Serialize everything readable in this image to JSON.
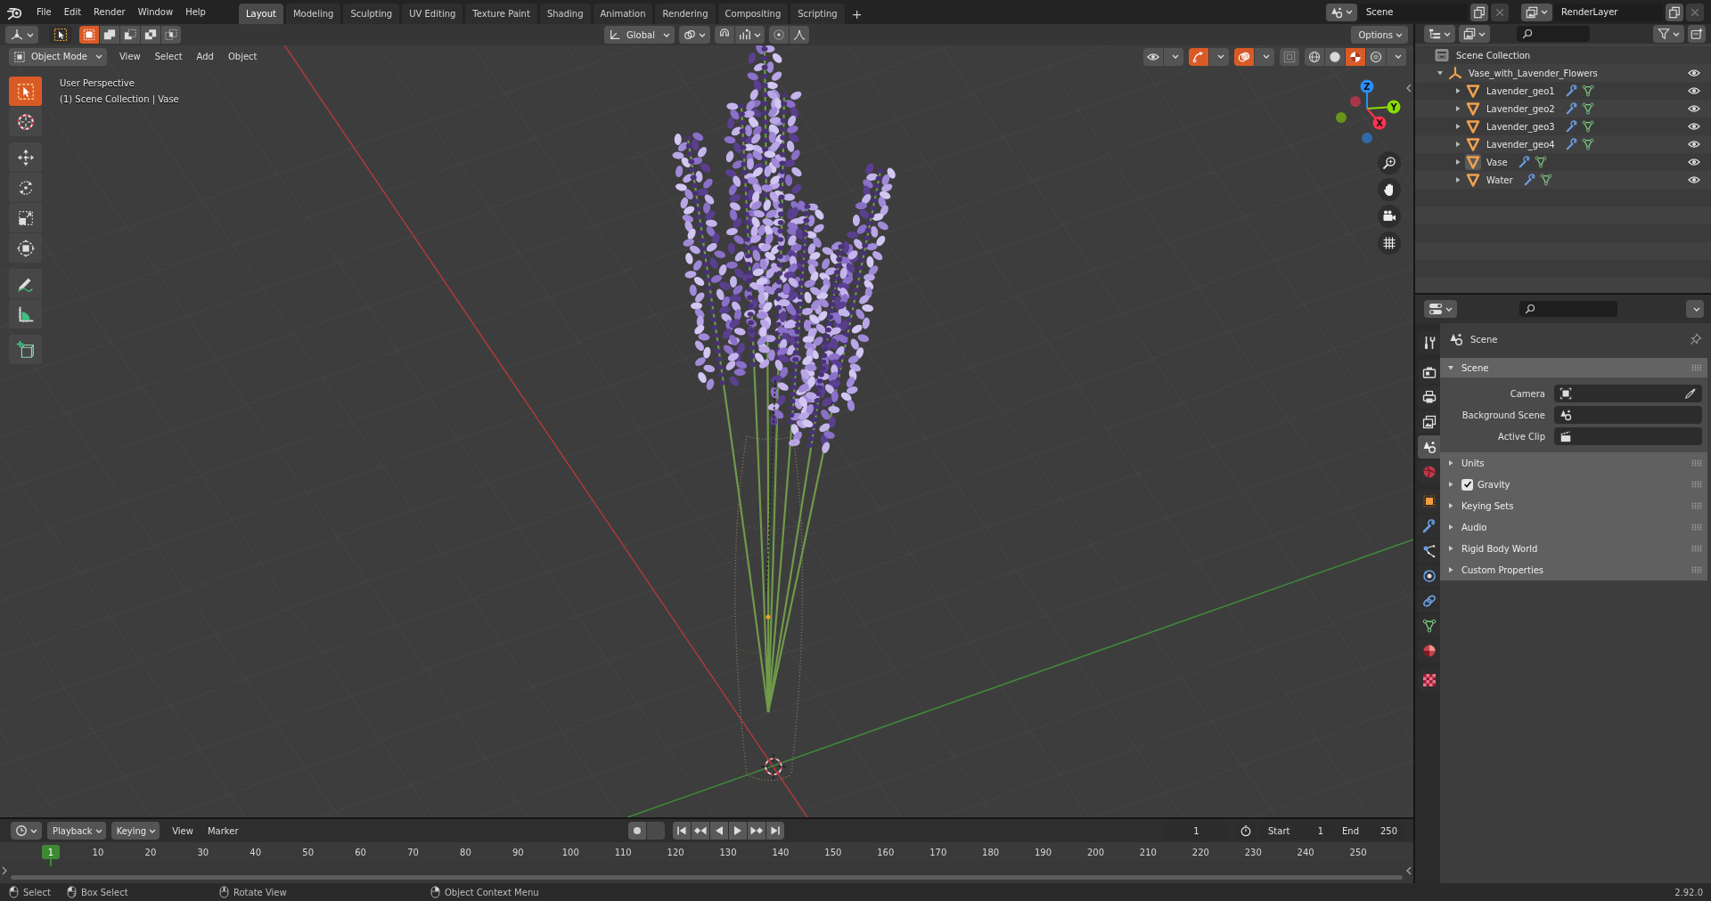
{
  "top_bar": {
    "menus": [
      "File",
      "Edit",
      "Render",
      "Window",
      "Help"
    ],
    "workspaces": [
      {
        "label": "Layout",
        "selected": true
      },
      {
        "label": "Modeling",
        "selected": false
      },
      {
        "label": "Sculpting",
        "selected": false
      },
      {
        "label": "UV Editing",
        "selected": false
      },
      {
        "label": "Texture Paint",
        "selected": false
      },
      {
        "label": "Shading",
        "selected": false
      },
      {
        "label": "Animation",
        "selected": false
      },
      {
        "label": "Rendering",
        "selected": false
      },
      {
        "label": "Compositing",
        "selected": false
      },
      {
        "label": "Scripting",
        "selected": false
      }
    ],
    "add_workspace": "+",
    "scene": "Scene",
    "view_layer": "RenderLayer"
  },
  "tool_header": {
    "selection_modes": [
      {
        "kind": "set",
        "selected": true
      },
      {
        "kind": "extend",
        "selected": false
      },
      {
        "kind": "subtract",
        "selected": false
      },
      {
        "kind": "difference",
        "selected": false
      },
      {
        "kind": "intersect",
        "selected": false
      }
    ],
    "orientation": "Global",
    "snap": false,
    "proportional_editing": false,
    "options": "Options"
  },
  "viewport_header": {
    "mode": "Object Mode",
    "menus": [
      "View",
      "Select",
      "Add",
      "Object"
    ],
    "gizmos": true,
    "overlays": true,
    "xray": false,
    "shading": [
      {
        "kind": "wireframe",
        "selected": false
      },
      {
        "kind": "solid",
        "selected": false
      },
      {
        "kind": "material",
        "selected": true
      },
      {
        "kind": "rendered",
        "selected": false
      }
    ]
  },
  "viewport": {
    "view_name": "User Perspective",
    "context": "(1) Scene Collection | Vase",
    "tools": [
      {
        "kind": "select_box",
        "selected": true
      },
      {
        "kind": "cursor",
        "selected": false
      },
      {
        "kind": "move",
        "selected": false
      },
      {
        "kind": "rotate",
        "selected": false
      },
      {
        "kind": "scale",
        "selected": false
      },
      {
        "kind": "transform",
        "selected": false
      },
      {
        "kind": "annotate",
        "selected": false
      },
      {
        "kind": "measure",
        "selected": false
      },
      {
        "kind": "add_cube",
        "selected": false
      }
    ],
    "gizmo_axes": [
      {
        "label": "Z",
        "color": "#2890ff"
      },
      {
        "label": "Y",
        "color": "#8bdc00"
      },
      {
        "label": "X",
        "color": "#ff3352"
      }
    ]
  },
  "outliner": {
    "tree": {
      "name": "Scene Collection",
      "kind": "scene_collection",
      "children": [
        {
          "name": "Vase_with_Lavender_Flowers",
          "kind": "empty",
          "expanded": true,
          "visible": true,
          "active": false,
          "children": [
            {
              "name": "Lavender_geo1",
              "kind": "mesh",
              "expanded": false,
              "visible": true,
              "active": false
            },
            {
              "name": "Lavender_geo2",
              "kind": "mesh",
              "expanded": false,
              "visible": true,
              "active": false
            },
            {
              "name": "Lavender_geo3",
              "kind": "mesh",
              "expanded": false,
              "visible": true,
              "active": false
            },
            {
              "name": "Lavender_geo4",
              "kind": "mesh",
              "expanded": false,
              "visible": true,
              "active": false
            },
            {
              "name": "Vase",
              "kind": "mesh",
              "expanded": false,
              "visible": true,
              "active": true
            },
            {
              "name": "Water",
              "kind": "mesh",
              "expanded": false,
              "visible": true,
              "active": false
            }
          ]
        }
      ]
    }
  },
  "properties": {
    "tabs": [
      {
        "kind": "tool",
        "selected": false
      },
      {
        "kind": "render",
        "selected": false
      },
      {
        "kind": "output",
        "selected": false
      },
      {
        "kind": "view_layer",
        "selected": false
      },
      {
        "kind": "scene",
        "selected": true
      },
      {
        "kind": "world",
        "selected": false
      },
      {
        "kind": "object",
        "selected": false
      },
      {
        "kind": "modifiers",
        "selected": false
      },
      {
        "kind": "particles",
        "selected": false
      },
      {
        "kind": "physics",
        "selected": false
      },
      {
        "kind": "constraints",
        "selected": false
      },
      {
        "kind": "data",
        "selected": false
      },
      {
        "kind": "material",
        "selected": false
      },
      {
        "kind": "texture",
        "selected": false
      }
    ],
    "context": "Scene",
    "panels": [
      {
        "title": "Scene",
        "kind": "plain",
        "expanded": true,
        "fields": [
          {
            "label": "Camera",
            "kind": "camera"
          },
          {
            "label": "Background Scene",
            "kind": "scene"
          },
          {
            "label": "Active Clip",
            "kind": "clip"
          }
        ]
      },
      {
        "title": "Units",
        "kind": "plain",
        "expanded": false
      },
      {
        "title": "Gravity",
        "kind": "toggle",
        "expanded": false,
        "checked": true
      },
      {
        "title": "Keying Sets",
        "kind": "plain",
        "expanded": false
      },
      {
        "title": "Audio",
        "kind": "plain",
        "expanded": false
      },
      {
        "title": "Rigid Body World",
        "kind": "plain",
        "expanded": false
      },
      {
        "title": "Custom Properties",
        "kind": "plain",
        "expanded": false
      }
    ]
  },
  "timeline": {
    "menus": [
      {
        "label": "Playback",
        "kind": "dropdown"
      },
      {
        "label": "Keying",
        "kind": "dropdown"
      },
      {
        "label": "View",
        "kind": "menu"
      },
      {
        "label": "Marker",
        "kind": "menu"
      }
    ],
    "auto_keying": false,
    "current_frame": "1",
    "start_label": "Start",
    "start": "1",
    "end_label": "End",
    "end": "250",
    "playhead": "1",
    "ruler": [
      "10",
      "20",
      "30",
      "40",
      "50",
      "60",
      "70",
      "80",
      "90",
      "100",
      "110",
      "120",
      "130",
      "140",
      "150",
      "160",
      "170",
      "180",
      "190",
      "200",
      "210",
      "220",
      "230",
      "240",
      "250"
    ]
  },
  "status_bar": {
    "hints": [
      {
        "kind": "left",
        "label": "Select"
      },
      {
        "kind": "drag",
        "label": "Box Select"
      },
      {
        "kind": "middle",
        "label": "Rotate View"
      },
      {
        "kind": "right",
        "label": "Object Context Menu"
      }
    ],
    "version": "2.92.0"
  }
}
